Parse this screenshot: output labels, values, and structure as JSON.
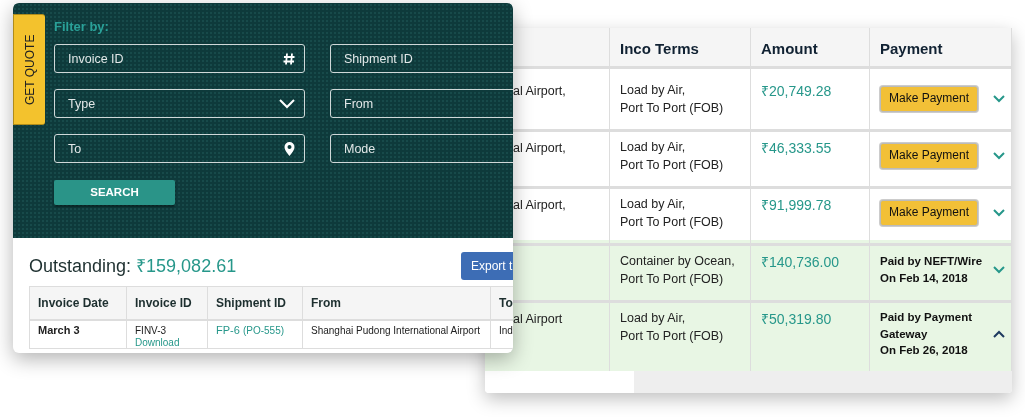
{
  "quote_tab": {
    "label": "GET QUOTE"
  },
  "filter": {
    "title": "Filter by:",
    "fields": [
      {
        "placeholder": "Invoice ID",
        "kind": "hash"
      },
      {
        "placeholder": "Shipment ID",
        "kind": "plain"
      },
      {
        "placeholder": "Type",
        "kind": "select"
      },
      {
        "placeholder": "From",
        "kind": "plain"
      },
      {
        "placeholder": "To",
        "kind": "location"
      },
      {
        "placeholder": "Mode",
        "kind": "plain"
      }
    ],
    "search_button": "SEARCH"
  },
  "outstanding": {
    "label": "Outstanding:",
    "amount": "₹159,082.61"
  },
  "export_button": "Export t",
  "invoice_table": {
    "columns": [
      "Invoice Date",
      "Invoice ID",
      "Shipment ID",
      "From",
      "To"
    ],
    "rows": [
      {
        "invoice_date": "March 3",
        "invoice_id": "FINV-3",
        "download": "Download",
        "shipment_id": "FP-6",
        "po": "(PO-555)",
        "from": "Shanghai Pudong International Airport",
        "to": "Ind"
      }
    ]
  },
  "payments_table": {
    "columns": [
      "Inco Terms",
      "Amount",
      "Payment"
    ],
    "rows": [
      {
        "location": "al Airport,",
        "inco_terms": [
          "Load by Air,",
          "Port To Port (FOB)"
        ],
        "amount": "₹20,749.28",
        "kind": "button",
        "payment": [
          "Make Payment"
        ],
        "expanded": false
      },
      {
        "location": "al Airport,",
        "inco_terms": [
          "Load by Air,",
          "Port To Port (FOB)"
        ],
        "amount": "₹46,333.55",
        "kind": "button",
        "payment": [
          "Make Payment"
        ],
        "expanded": false
      },
      {
        "location": "al Airport,",
        "inco_terms": [
          "Load by Air,",
          "Port To Port (FOB)"
        ],
        "amount": "₹91,999.78",
        "kind": "button",
        "payment": [
          "Make Payment"
        ],
        "expanded": false
      },
      {
        "inco_terms": [
          "Container by Ocean,",
          "Port To Port (FOB)"
        ],
        "amount": "₹140,736.00",
        "kind": "paid",
        "payment": [
          "Paid by NEFT/Wire",
          "On Feb 14, 2018"
        ],
        "expanded": false
      },
      {
        "location": "al Airport",
        "inco_terms": [
          "Load by Air,",
          "Port To Port (FOB)"
        ],
        "amount": "₹50,319.80",
        "kind": "paid",
        "payment": [
          "Paid by Payment Gateway",
          "On Feb 26, 2018"
        ],
        "expanded": true
      }
    ]
  }
}
